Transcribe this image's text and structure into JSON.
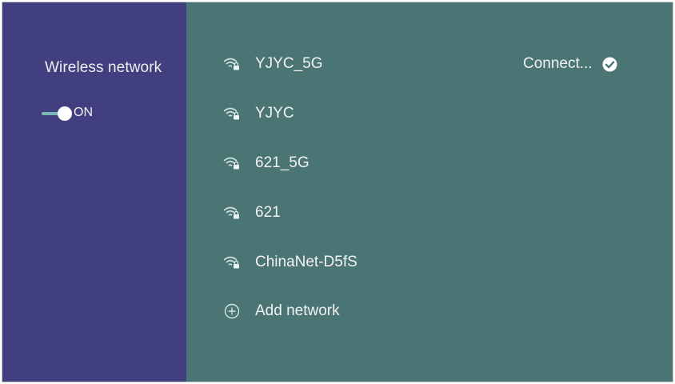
{
  "sidebar": {
    "title": "Wireless network",
    "toggle": {
      "label": "ON",
      "state": "on"
    }
  },
  "networks": [
    {
      "name": "YJYC_5G",
      "status": "Connect...",
      "icon": "wifi-lock-icon",
      "connected": true
    },
    {
      "name": "YJYC",
      "icon": "wifi-lock-icon"
    },
    {
      "name": "621_5G",
      "icon": "wifi-lock-icon"
    },
    {
      "name": "621",
      "icon": "wifi-lock-icon"
    },
    {
      "name": "ChinaNet-D5fS",
      "icon": "wifi-lock-icon"
    }
  ],
  "add_network": {
    "label": "Add network",
    "icon": "plus-circle-icon"
  },
  "colors": {
    "sidebar_bg": "#423f80",
    "main_bg": "#4a7574",
    "text": "#f2f2f2",
    "toggle_track": "#78b7b7"
  }
}
